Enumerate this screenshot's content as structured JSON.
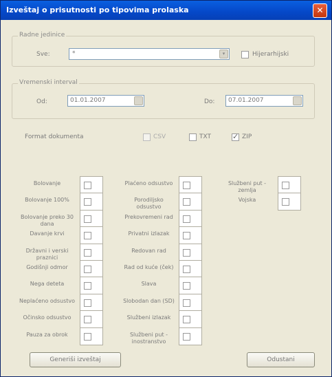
{
  "window": {
    "title": "Izveštaj o prisutnosti po tipovima prolaska",
    "close_glyph": "✕"
  },
  "org_unit": {
    "legend": "Radne jedinice",
    "label": "Sve:",
    "value": "*",
    "dropdown_glyph": "▾",
    "checkbox_label": "Hijerarhijski"
  },
  "time_interval": {
    "legend": "Vremenski interval",
    "from_label": "Od:",
    "from_value": "01.01.2007",
    "to_label": "Do:",
    "to_value": "07.01.2007"
  },
  "doc_format": {
    "label": "Format dokumenta",
    "options": [
      {
        "label": "CSV",
        "checked": false,
        "disabled": true
      },
      {
        "label": "TXT",
        "checked": false,
        "disabled": false
      },
      {
        "label": "ZIP",
        "checked": true,
        "disabled": false
      }
    ]
  },
  "pass_types": {
    "col1": [
      "Bolovanje",
      "Bolovanje 100%",
      "Bolovanje preko 30 dana",
      "Davanje krvi",
      "Državni i verski praznici",
      "Godišnji odmor",
      "Nega deteta",
      "Neplaćeno odsustvo",
      "Očinsko odsustvo",
      "Pauza za obrok"
    ],
    "col2": [
      "Plaćeno odsustvo",
      "Porodiljsko odsustvo",
      "Prekovremeni rad",
      "Privatni izlazak",
      "Redovan rad",
      "Rad od kuće (ček)",
      "Slava",
      "Slobodan dan (SD)",
      "Službeni izlazak",
      "Službeni put - inostranstvo"
    ],
    "col3": [
      "Službeni put - zemlja",
      "Vojska"
    ]
  },
  "buttons": {
    "generate": "Generiši izveštaj",
    "cancel": "Odustani"
  }
}
